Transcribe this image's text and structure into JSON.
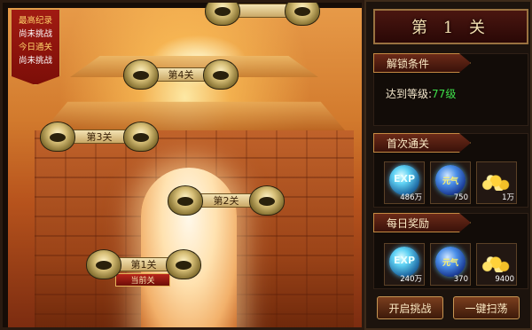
{
  "ribbon": {
    "best_record_label": "最高纪录",
    "best_record_value": "尚未挑战",
    "today_clear_label": "今日通关",
    "today_clear_value": "尚未挑战"
  },
  "stages": [
    {
      "label": "第4关"
    },
    {
      "label": "第3关"
    },
    {
      "label": "第2关"
    },
    {
      "label": "第1关"
    }
  ],
  "current_tag": "当前关",
  "panel": {
    "title": "第 1 关",
    "unlock": {
      "header": "解锁条件",
      "text_prefix": "达到等级:",
      "level": "77级"
    },
    "first_clear": {
      "header": "首次通关",
      "rewards": [
        {
          "icon": "exp-orb-icon",
          "label": "EXP",
          "qty": "486万"
        },
        {
          "icon": "yuanqi-orb-icon",
          "label": "元气",
          "qty": "750"
        },
        {
          "icon": "gold-coins-icon",
          "label": "",
          "qty": "1万"
        }
      ]
    },
    "daily": {
      "header": "每日奖励",
      "rewards": [
        {
          "icon": "exp-orb-icon",
          "label": "EXP",
          "qty": "240万"
        },
        {
          "icon": "yuanqi-orb-icon",
          "label": "元气",
          "qty": "370"
        },
        {
          "icon": "gold-coins-icon",
          "label": "",
          "qty": "9400"
        }
      ]
    },
    "buttons": {
      "start": "开启挑战",
      "sweep": "一键扫荡"
    }
  },
  "colors": {
    "level_green": "#3ee04a",
    "ribbon_gold": "#ffd36a",
    "ribbon_red": "#a11b12"
  }
}
